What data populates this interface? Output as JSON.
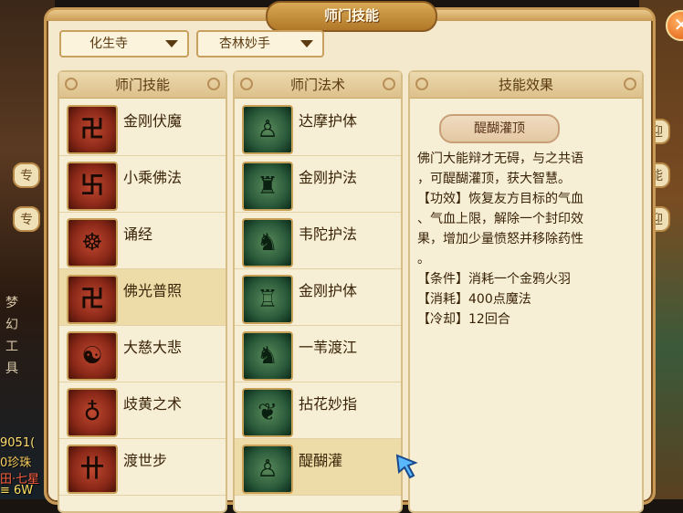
{
  "window": {
    "title": "师门技能",
    "close_symbol": "✕"
  },
  "filters": {
    "school": "化生寺",
    "sub_school": "杏林妙手"
  },
  "columns": {
    "skills_header": "师门技能",
    "spells_header": "师门法术",
    "effect_header": "技能效果"
  },
  "skills": [
    {
      "name": "金刚伏魔",
      "glyph": "卍"
    },
    {
      "name": "小乘佛法",
      "glyph": "卐"
    },
    {
      "name": "诵经",
      "glyph": "☸"
    },
    {
      "name": "佛光普照",
      "glyph": "卍",
      "selected": true
    },
    {
      "name": "大慈大悲",
      "glyph": "☯"
    },
    {
      "name": "歧黄之术",
      "glyph": "♁"
    },
    {
      "name": "渡世步",
      "glyph": "卄"
    }
  ],
  "spells": [
    {
      "name": "达摩护体",
      "glyph": "♙"
    },
    {
      "name": "金刚护法",
      "glyph": "♜"
    },
    {
      "name": "韦陀护法",
      "glyph": "♞"
    },
    {
      "name": "金刚护体",
      "glyph": "♖"
    },
    {
      "name": "一苇渡江",
      "glyph": "♞"
    },
    {
      "name": "拈花妙指",
      "glyph": "❦"
    },
    {
      "name": "醍醐灌",
      "glyph": "♙",
      "selected": true
    }
  ],
  "effect": {
    "skill_name": "醍醐灌顶",
    "lines": [
      "佛门大能辩才无碍，与之共语",
      "，可醍醐灌顶，获大智慧。",
      "【功效】恢复友方目标的气血",
      "、气血上限，解除一个封印效",
      "果，增加少量愤怒并移除药性",
      "。",
      "【条件】消耗一个金鸦火羽",
      "【消耗】400点魔法",
      "【冷却】12回合"
    ]
  },
  "background": {
    "left_tab_1": "专",
    "left_tab_2": "专",
    "vertical_text": "梦幻工具",
    "bottom_lines": [
      "9051(",
      "0珍珠",
      "田·七星",
      "≡  6W"
    ],
    "right_tab_1": "迎",
    "right_tab_2": "能",
    "right_tab_3": "迎"
  }
}
